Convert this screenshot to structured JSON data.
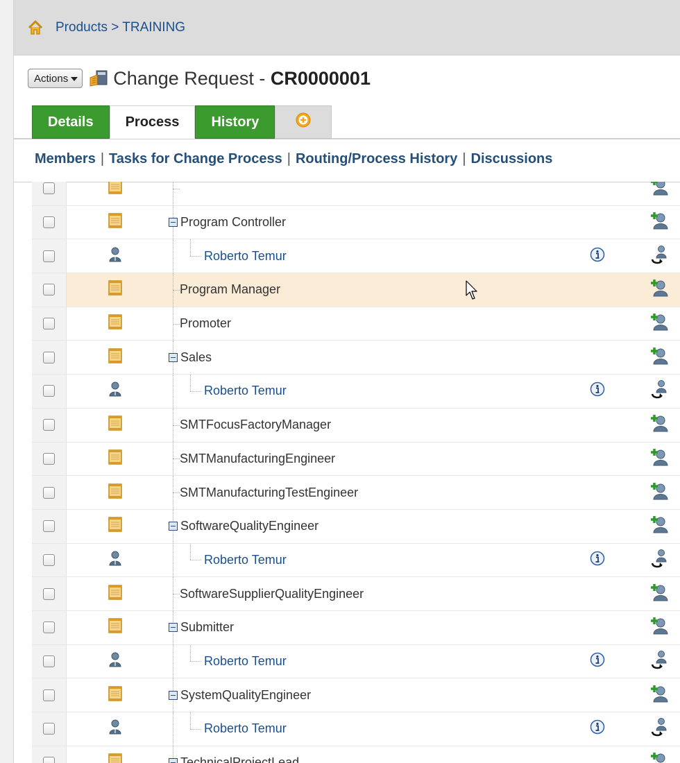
{
  "breadcrumb": {
    "products": "Products",
    "separator": " > ",
    "current": "TRAINING"
  },
  "header": {
    "actions_label": "Actions",
    "title_prefix": "Change Request - ",
    "title_id": "CR0000001"
  },
  "tabs": [
    {
      "label": "Details",
      "active": false
    },
    {
      "label": "Process",
      "active": true
    },
    {
      "label": "History",
      "active": false
    }
  ],
  "subnav": {
    "members": "Members",
    "tasks": "Tasks for Change Process",
    "routing": "Routing/Process History",
    "discussions": "Discussions",
    "separator": "|"
  },
  "rows": [
    {
      "type": "role",
      "label": "",
      "level": 0,
      "collapsible": false,
      "partial": true
    },
    {
      "type": "role",
      "label": "Program Controller",
      "level": 0,
      "collapsible": true
    },
    {
      "type": "person",
      "label": "Roberto Temur",
      "level": 1
    },
    {
      "type": "role",
      "label": "Program Manager",
      "level": 0,
      "collapsible": false,
      "hover": true
    },
    {
      "type": "role",
      "label": "Promoter",
      "level": 0,
      "collapsible": false
    },
    {
      "type": "role",
      "label": "Sales",
      "level": 0,
      "collapsible": true
    },
    {
      "type": "person",
      "label": "Roberto Temur",
      "level": 1
    },
    {
      "type": "role",
      "label": "SMTFocusFactoryManager",
      "level": 0,
      "collapsible": false
    },
    {
      "type": "role",
      "label": "SMTManufacturingEngineer",
      "level": 0,
      "collapsible": false
    },
    {
      "type": "role",
      "label": "SMTManufacturingTestEngineer",
      "level": 0,
      "collapsible": false
    },
    {
      "type": "role",
      "label": "SoftwareQualityEngineer",
      "level": 0,
      "collapsible": true
    },
    {
      "type": "person",
      "label": "Roberto Temur",
      "level": 1
    },
    {
      "type": "role",
      "label": "SoftwareSupplierQualityEngineer",
      "level": 0,
      "collapsible": false
    },
    {
      "type": "role",
      "label": "Submitter",
      "level": 0,
      "collapsible": true
    },
    {
      "type": "person",
      "label": "Roberto Temur",
      "level": 1
    },
    {
      "type": "role",
      "label": "SystemQualityEngineer",
      "level": 0,
      "collapsible": true
    },
    {
      "type": "person",
      "label": "Roberto Temur",
      "level": 1
    },
    {
      "type": "role",
      "label": "TechnicalProjectLead",
      "level": 0,
      "collapsible": true
    }
  ],
  "icons": {
    "home": "home-icon",
    "change_request": "change-request-icon",
    "add_tab": "add-tab-icon",
    "role": "role-icon",
    "person": "person-icon",
    "info": "info-icon",
    "add_member": "add-member-icon",
    "reassign": "reassign-user-icon",
    "cursor": "mouse-pointer-icon"
  },
  "colors": {
    "tab_green": "#3c9b2e",
    "link_blue": "#1a4f8b",
    "hover_row": "#fbecd8"
  }
}
